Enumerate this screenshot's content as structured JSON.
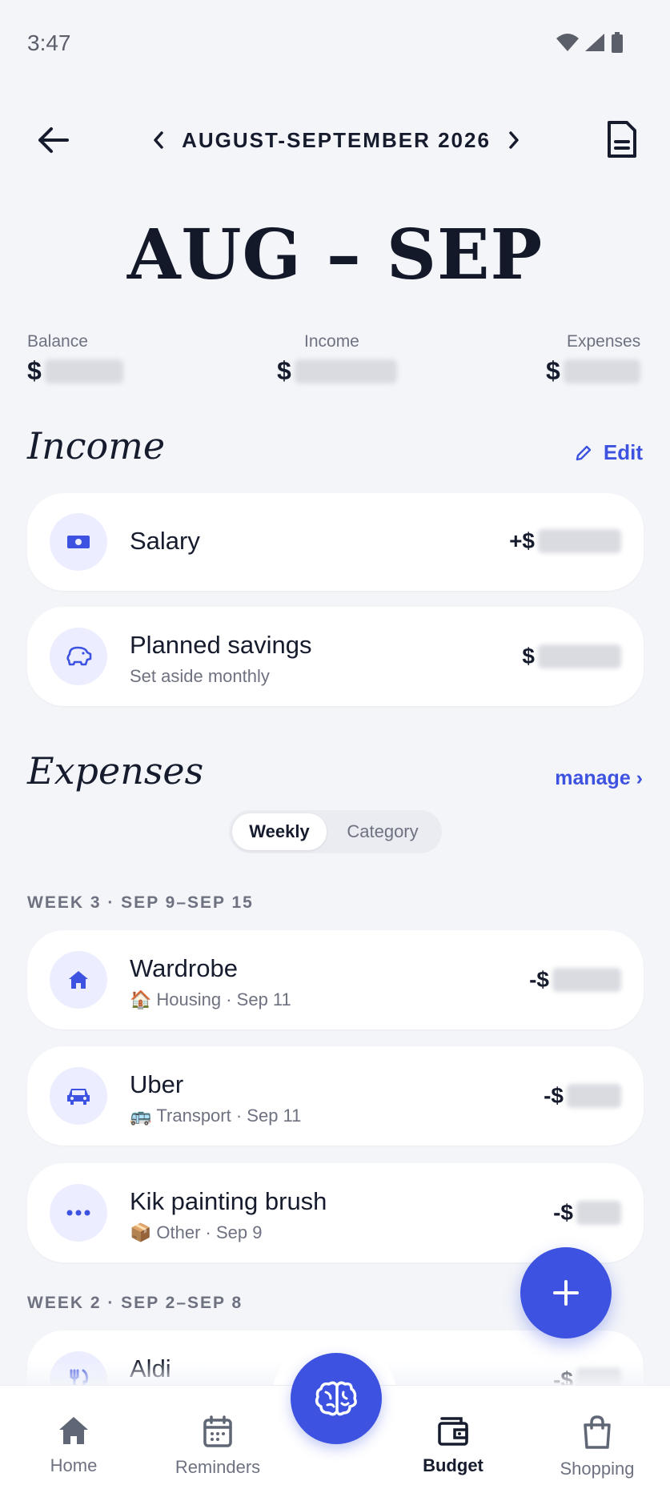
{
  "status_bar": {
    "time": "3:47"
  },
  "header": {
    "period_label": "AUGUST-SEPTEMBER 2026",
    "title": "AUG – SEP"
  },
  "summary": {
    "balance": {
      "label": "Balance",
      "currency": "$"
    },
    "income": {
      "label": "Income",
      "currency": "$"
    },
    "expenses": {
      "label": "Expenses",
      "currency": "$"
    }
  },
  "income_section": {
    "title": "Income",
    "edit_label": "Edit",
    "items": [
      {
        "name": "Salary",
        "amount_prefix": "+$",
        "icon": "banknote-icon"
      },
      {
        "name": "Planned savings",
        "subtitle": "Set aside monthly",
        "amount_prefix": "$",
        "icon": "piggy-bank-icon"
      }
    ]
  },
  "expenses_section": {
    "title": "Expenses",
    "manage_label": "manage ›",
    "tabs": [
      {
        "label": "Weekly",
        "selected": true
      },
      {
        "label": "Category",
        "selected": false
      }
    ],
    "weeks": [
      {
        "header": "WEEK 3 · SEP 9–SEP 15",
        "items": [
          {
            "name": "Wardrobe",
            "category_emoji": "🏠",
            "category": "Housing · Sep 11",
            "amount_prefix": "-$",
            "icon": "home-icon"
          },
          {
            "name": "Uber",
            "category_emoji": "🚌",
            "category": "Transport · Sep 11",
            "amount_prefix": "-$",
            "icon": "car-icon"
          },
          {
            "name": "Kik painting brush",
            "category_emoji": "📦",
            "category": "Other · Sep 9",
            "amount_prefix": "-$",
            "icon": "more-dots-icon"
          }
        ]
      },
      {
        "header": "WEEK 2 · SEP 2–SEP 8",
        "items": [
          {
            "name": "Aldi",
            "amount_prefix": "-$",
            "icon": "utensils-icon"
          }
        ]
      }
    ]
  },
  "fab": {
    "icon": "plus-icon"
  },
  "bottom_nav": {
    "items": [
      {
        "label": "Home",
        "icon": "home-icon"
      },
      {
        "label": "Reminders",
        "icon": "calendar-icon"
      },
      {
        "label": "Budget",
        "icon": "wallet-icon",
        "active": true
      },
      {
        "label": "Shopping",
        "icon": "shopping-bag-icon"
      }
    ],
    "center_icon": "brain-icon"
  },
  "colors": {
    "accent": "#3d52e0",
    "background": "#f3f5f9",
    "icon_bg": "#eceeff"
  }
}
